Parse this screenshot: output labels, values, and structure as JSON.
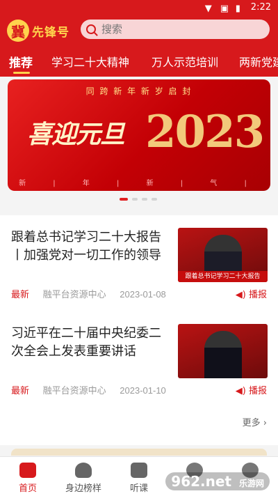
{
  "status": {
    "time": "2:22"
  },
  "header": {
    "logo_seal": "冀",
    "logo_text": "先锋号"
  },
  "search": {
    "placeholder": "搜索"
  },
  "tabs": [
    "推荐",
    "学习二十大精神",
    "万人示范培训",
    "两新党建"
  ],
  "banner": {
    "caption": "同 跨 新 年     新 岁 启 封",
    "title": "喜迎元旦",
    "year": "2023",
    "strip": "新 | 年 | 新 | 气 | 象"
  },
  "news": [
    {
      "title": "跟着总书记学习二十大报告丨加强党对一切工作的领导",
      "tag": "最新",
      "source": "融平台资源中心",
      "date": "2023-01-08",
      "play": "播报",
      "thumb_caption": "跟着总书记学习二十大报告"
    },
    {
      "title": "习近平在二十届中央纪委二次全会上发表重要讲话",
      "tag": "最新",
      "source": "融平台资源中心",
      "date": "2023-01-10",
      "play": "播报"
    }
  ],
  "more": "更多 ›",
  "nav": [
    "首页",
    "身边榜样",
    "听课"
  ],
  "watermark": {
    "logo": "962.net",
    "text": "乐游网"
  },
  "colors": {
    "brand": "#d7191c",
    "accent": "#ffd34d"
  }
}
